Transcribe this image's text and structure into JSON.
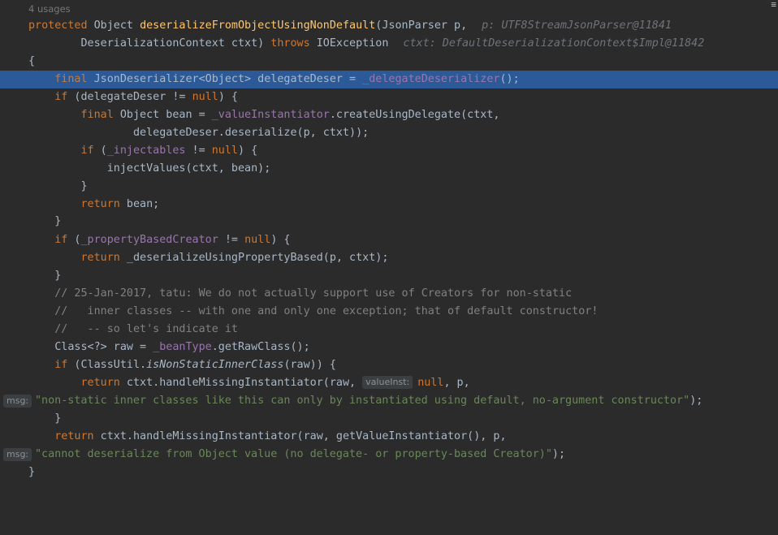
{
  "usages_label": "4 usages",
  "corner_mark": "≡",
  "line1": {
    "kw": "protected",
    "type": " Object ",
    "name": "deserializeFromObjectUsingNonDefault",
    "params": "(JsonParser p,",
    "hint": "p: UTF8StreamJsonParser@11841"
  },
  "line2": {
    "a": "        DeserializationContext ctxt) ",
    "kw": "throws",
    "b": " IOException",
    "hint": "ctxt: DefaultDeserializationContext$Impl@11842"
  },
  "line3": {
    "text": "{"
  },
  "line4": {
    "indent": "    ",
    "kw": "final",
    "a": " JsonDeserializer<Object> delegateDeser = ",
    "call": "_delegateDeserializer",
    "b": "();"
  },
  "line5": {
    "indent": "    ",
    "kw": "if",
    "a": " (delegateDeser != ",
    "kw2": "null",
    "b": ") {"
  },
  "line6": {
    "indent": "        ",
    "kw": "final",
    "a": " Object bean = ",
    "fld": "_valueInstantiator",
    "b": ".createUsingDelegate(ctxt,"
  },
  "line7": {
    "indent": "                ",
    "a": "delegateDeser.deserialize(p, ctxt));"
  },
  "line8": {
    "indent": "        ",
    "kw": "if",
    "a": " (",
    "fld": "_injectables",
    "b": " != ",
    "kw2": "null",
    "c": ") {"
  },
  "line9": {
    "indent": "            ",
    "a": "injectValues(ctxt, bean);"
  },
  "line10": {
    "indent": "        ",
    "a": "}"
  },
  "line11": {
    "indent": "        ",
    "kw": "return",
    "a": " bean;"
  },
  "line12": {
    "indent": "    ",
    "a": "}"
  },
  "line13": {
    "indent": "    ",
    "kw": "if",
    "a": " (",
    "fld": "_propertyBasedCreator",
    "b": " != ",
    "kw2": "null",
    "c": ") {"
  },
  "line14": {
    "indent": "        ",
    "kw": "return",
    "a": " _deserializeUsingPropertyBased(p, ctxt);"
  },
  "line15": {
    "indent": "    ",
    "a": "}"
  },
  "line16": {
    "indent": "    ",
    "cmt": "// 25-Jan-2017, tatu: We do not actually support use of Creators for non-static"
  },
  "line17": {
    "indent": "    ",
    "cmt": "//   inner classes -- with one and only one exception; that of default constructor!"
  },
  "line18": {
    "indent": "    ",
    "cmt": "//   -- so let's indicate it"
  },
  "line19": {
    "indent": "    ",
    "a": "Class<?> raw = ",
    "fld": "_beanType",
    "b": ".getRawClass();"
  },
  "line20": {
    "indent": "    ",
    "kw": "if",
    "a": " (ClassUtil.",
    "itl": "isNonStaticInnerClass",
    "b": "(raw)) {"
  },
  "line21": {
    "indent": "        ",
    "kw": "return",
    "a": " ctxt.handleMissingInstantiator(raw, ",
    "badge": "valueInst:",
    "kw2": "null",
    "b": ", p,"
  },
  "line22": {
    "badge": "msg:",
    "str": "\"non-static inner classes like this can only by instantiated using default, no-argument constructor\"",
    "a": ");"
  },
  "line23": {
    "indent": "    ",
    "a": "}"
  },
  "line24": {
    "indent": "    ",
    "kw": "return",
    "a": " ctxt.handleMissingInstantiator(raw, getValueInstantiator(), p,"
  },
  "line25": {
    "badge": "msg:",
    "str": "\"cannot deserialize from Object value (no delegate- or property-based Creator)\"",
    "a": ");"
  },
  "line26": {
    "text": "}"
  }
}
